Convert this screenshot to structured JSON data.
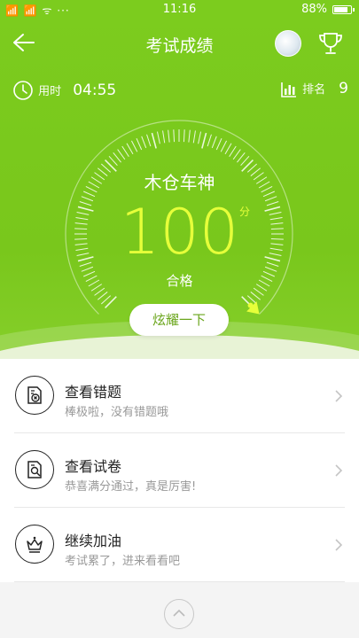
{
  "status_bar": {
    "signals": "📶 📶 ᯤ ···",
    "time": "11:16",
    "battery": "88%",
    "battery_level": 0.88
  },
  "header": {
    "title": "考试成绩"
  },
  "stats": {
    "time_label": "用时",
    "time_value": "04:55",
    "rank_label": "排名",
    "rank_value": "9"
  },
  "result": {
    "user_name": "木仓车神",
    "score": "100",
    "unit": "分",
    "status": "合格",
    "score_fraction": 1.0,
    "brag_button": "炫耀一下"
  },
  "actions": [
    {
      "title": "查看错题",
      "subtitle": "棒极啦，没有错题哦",
      "icon": "wrong-questions-icon"
    },
    {
      "title": "查看试卷",
      "subtitle": "恭喜满分通过，真是厉害!",
      "icon": "view-paper-icon"
    },
    {
      "title": "继续加油",
      "subtitle": "考试累了，进来看看吧",
      "icon": "crown-icon"
    }
  ],
  "colors": {
    "primary_green": "#7ccc1e",
    "score_yellow": "#e6ff3a"
  }
}
